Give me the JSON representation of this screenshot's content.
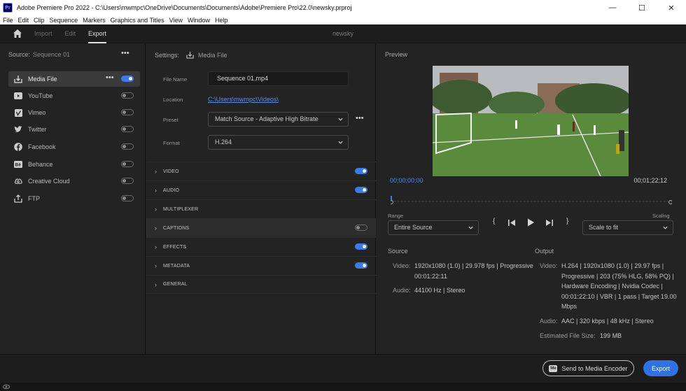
{
  "window": {
    "title": "Adobe Premiere Pro 2022 - C:\\Users\\mwmpc\\OneDrive\\Documents\\Documents\\Adobe\\Premiere Pro\\22.0\\newsky.prproj",
    "app_icon": "Pr",
    "controls": {
      "minimize": "—",
      "maximize": "☐",
      "close": "✕"
    }
  },
  "menubar": [
    "File",
    "Edit",
    "Clip",
    "Sequence",
    "Markers",
    "Graphics and Titles",
    "View",
    "Window",
    "Help"
  ],
  "topnav": {
    "tabs": [
      "Import",
      "Edit",
      "Export"
    ],
    "active_tab": "Export",
    "project_name": "newsky"
  },
  "source": {
    "label": "Source:",
    "value": "Sequence 01",
    "more": "•••"
  },
  "destinations": [
    {
      "label": "Media File",
      "icon": "media-file-icon",
      "on": true
    },
    {
      "label": "YouTube",
      "icon": "youtube-icon",
      "on": false
    },
    {
      "label": "Vimeo",
      "icon": "vimeo-icon",
      "on": false
    },
    {
      "label": "Twitter",
      "icon": "twitter-icon",
      "on": false
    },
    {
      "label": "Facebook",
      "icon": "facebook-icon",
      "on": false
    },
    {
      "label": "Behance",
      "icon": "behance-icon",
      "on": false
    },
    {
      "label": "Creative Cloud",
      "icon": "creative-cloud-icon",
      "on": false
    },
    {
      "label": "FTP",
      "icon": "ftp-icon",
      "on": false
    }
  ],
  "settings": {
    "label": "Settings:",
    "target": "Media File",
    "file_name_label": "File Name",
    "file_name": "Sequence 01.mp4",
    "location_label": "Location",
    "location": "C:\\Users\\mwmpc\\Videos\\",
    "preset_label": "Preset",
    "preset": "Match Source - Adaptive High Bitrate",
    "format_label": "Format",
    "format": "H.264",
    "sections": [
      {
        "name": "VIDEO",
        "toggle": true,
        "on": true
      },
      {
        "name": "AUDIO",
        "toggle": true,
        "on": true
      },
      {
        "name": "MULTIPLEXER",
        "toggle": false
      },
      {
        "name": "CAPTIONS",
        "toggle": true,
        "on": false
      },
      {
        "name": "EFFECTS",
        "toggle": true,
        "on": true
      },
      {
        "name": "METADATA",
        "toggle": true,
        "on": true
      },
      {
        "name": "GENERAL",
        "toggle": false
      }
    ]
  },
  "preview": {
    "label": "Preview",
    "timecode_in": "00;00;00;00",
    "timecode_out": "00;01;22;12",
    "range_label": "Range",
    "range": "Entire Source",
    "scaling_label": "Scaling",
    "scaling": "Scale to fit",
    "playhead_progress": 0
  },
  "source_info": {
    "heading": "Source",
    "video_label": "Video:",
    "video_lines": [
      "1920x1080 (1.0)  |  29.978 fps  |  Progressive",
      "00:01:22:11"
    ],
    "audio_label": "Audio:",
    "audio": "44100 Hz  |  Stereo"
  },
  "output_info": {
    "heading": "Output",
    "video_label": "Video:",
    "video_lines": [
      "H.264  |  1920x1080 (1.0)  |  29.97 fps  |",
      "Progressive  |  203 (75% HLG, 58% PQ)  |",
      "Hardware Encoding  |  Nvidia Codec  |",
      "00:01:22:10  |  VBR  |  1 pass  |  Target 19.00",
      "Mbps"
    ],
    "audio_label": "Audio:",
    "audio": "AAC  |  320 kbps  |  48 kHz  |  Stereo",
    "filesize_label": "Estimated File Size:",
    "filesize": "199 MB"
  },
  "footer": {
    "encoder_icon": "Me",
    "send_to_encoder": "Send to Media Encoder",
    "export": "Export"
  },
  "colors": {
    "accent": "#2f73e0",
    "link": "#5a8fe0",
    "timecode": "#4a8bf0"
  }
}
